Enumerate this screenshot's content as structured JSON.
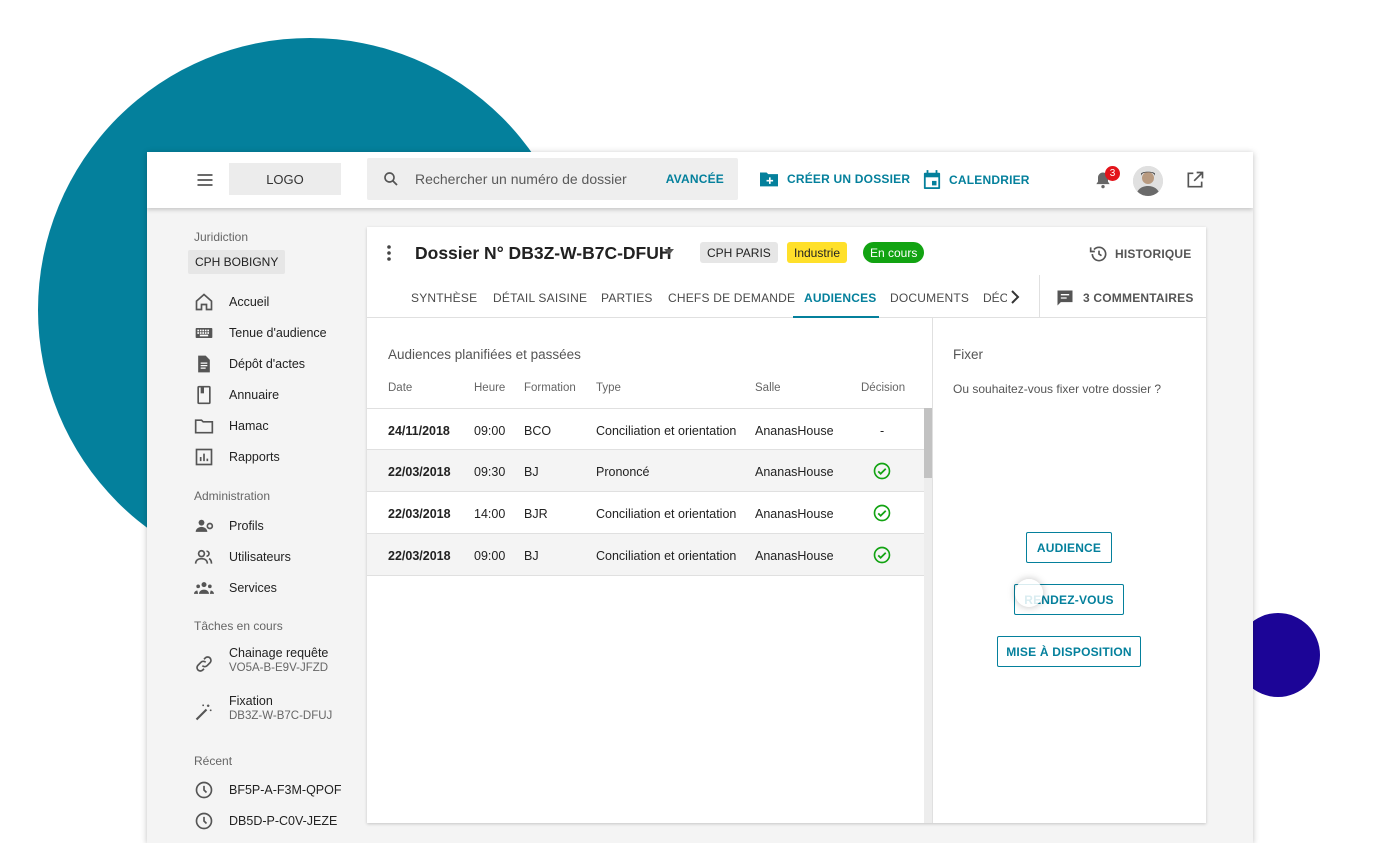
{
  "topbar": {
    "logo": "LOGO",
    "search_placeholder": "Rechercher un numéro de dossier",
    "advanced": "AVANCÉE",
    "create_folder": "CRÉER UN DOSSIER",
    "calendar": "CALENDRIER",
    "notifications_count": "3"
  },
  "sidebar": {
    "juridiction_label": "Juridiction",
    "juridiction_value": "CPH BOBIGNY",
    "main_items": [
      {
        "label": "Accueil",
        "icon": "home-icon"
      },
      {
        "label": "Tenue d'audience",
        "icon": "keyboard-icon"
      },
      {
        "label": "Dépôt d'actes",
        "icon": "document-icon"
      },
      {
        "label": "Annuaire",
        "icon": "book-icon"
      },
      {
        "label": "Hamac",
        "icon": "folder-icon"
      },
      {
        "label": "Rapports",
        "icon": "chart-icon"
      }
    ],
    "admin_label": "Administration",
    "admin_items": [
      {
        "label": "Profils",
        "icon": "profile-settings-icon"
      },
      {
        "label": "Utilisateurs",
        "icon": "users-icon"
      },
      {
        "label": "Services",
        "icon": "group-icon"
      }
    ],
    "tasks_label": "Tâches en cours",
    "tasks": [
      {
        "label": "Chainage requête",
        "sub": "VO5A-B-E9V-JFZD",
        "icon": "link-icon"
      },
      {
        "label": "Fixation",
        "sub": "DB3Z-W-B7C-DFUJ",
        "icon": "magic-wand-icon"
      }
    ],
    "recent_label": "Récent",
    "recent": [
      {
        "label": "BF5P-A-F3M-QPOF",
        "icon": "clock-icon"
      },
      {
        "label": "DB5D-P-C0V-JEZE",
        "icon": "clock-icon"
      }
    ]
  },
  "dossier": {
    "title": "Dossier N° DB3Z-W-B7C-DFUH",
    "tags": {
      "juridiction": "CPH PARIS",
      "type": "Industrie",
      "status": "En cours"
    },
    "status_color": "#12a312",
    "industry_color": "#ffe02a",
    "history": "HISTORIQUE",
    "tabs": [
      "SYNTHÈSE",
      "DÉTAIL SAISINE",
      "PARTIES",
      "CHEFS DE DEMANDE",
      "AUDIENCES",
      "DOCUMENTS"
    ],
    "tab_cut": "DÉCISIONS",
    "active_tab": "AUDIENCES",
    "comments": "3 COMMENTAIRES"
  },
  "audiences": {
    "title": "Audiences planifiées et passées",
    "columns": [
      "Date",
      "Heure",
      "Formation",
      "Type",
      "Salle",
      "Décision"
    ],
    "rows": [
      {
        "date": "24/11/2018",
        "heure": "09:00",
        "formation": "BCO",
        "type": "Conciliation et orientation",
        "salle": "AnanasHouse",
        "decision": "-"
      },
      {
        "date": "22/03/2018",
        "heure": "09:30",
        "formation": "BJ",
        "type": "Prononcé",
        "salle": "AnanasHouse",
        "decision": "check-circle-icon"
      },
      {
        "date": "22/03/2018",
        "heure": "14:00",
        "formation": "BJR",
        "type": "Conciliation et orientation",
        "salle": "AnanasHouse",
        "decision": "check-circle-icon"
      },
      {
        "date": "22/03/2018",
        "heure": "09:00",
        "formation": "BJ",
        "type": "Conciliation et orientation",
        "salle": "AnanasHouse",
        "decision": "check-circle-icon"
      }
    ]
  },
  "fixer": {
    "title": "Fixer",
    "question": "Ou souhaitez-vous fixer votre dossier ?",
    "buttons": [
      "AUDIENCE",
      "RENDEZ-VOUS",
      "MISE À DISPOSITION"
    ]
  },
  "colors": {
    "accent": "#04809c",
    "bg_circle": "#04809c",
    "bg_circle_small": "#1c0597",
    "success": "#12a312"
  }
}
